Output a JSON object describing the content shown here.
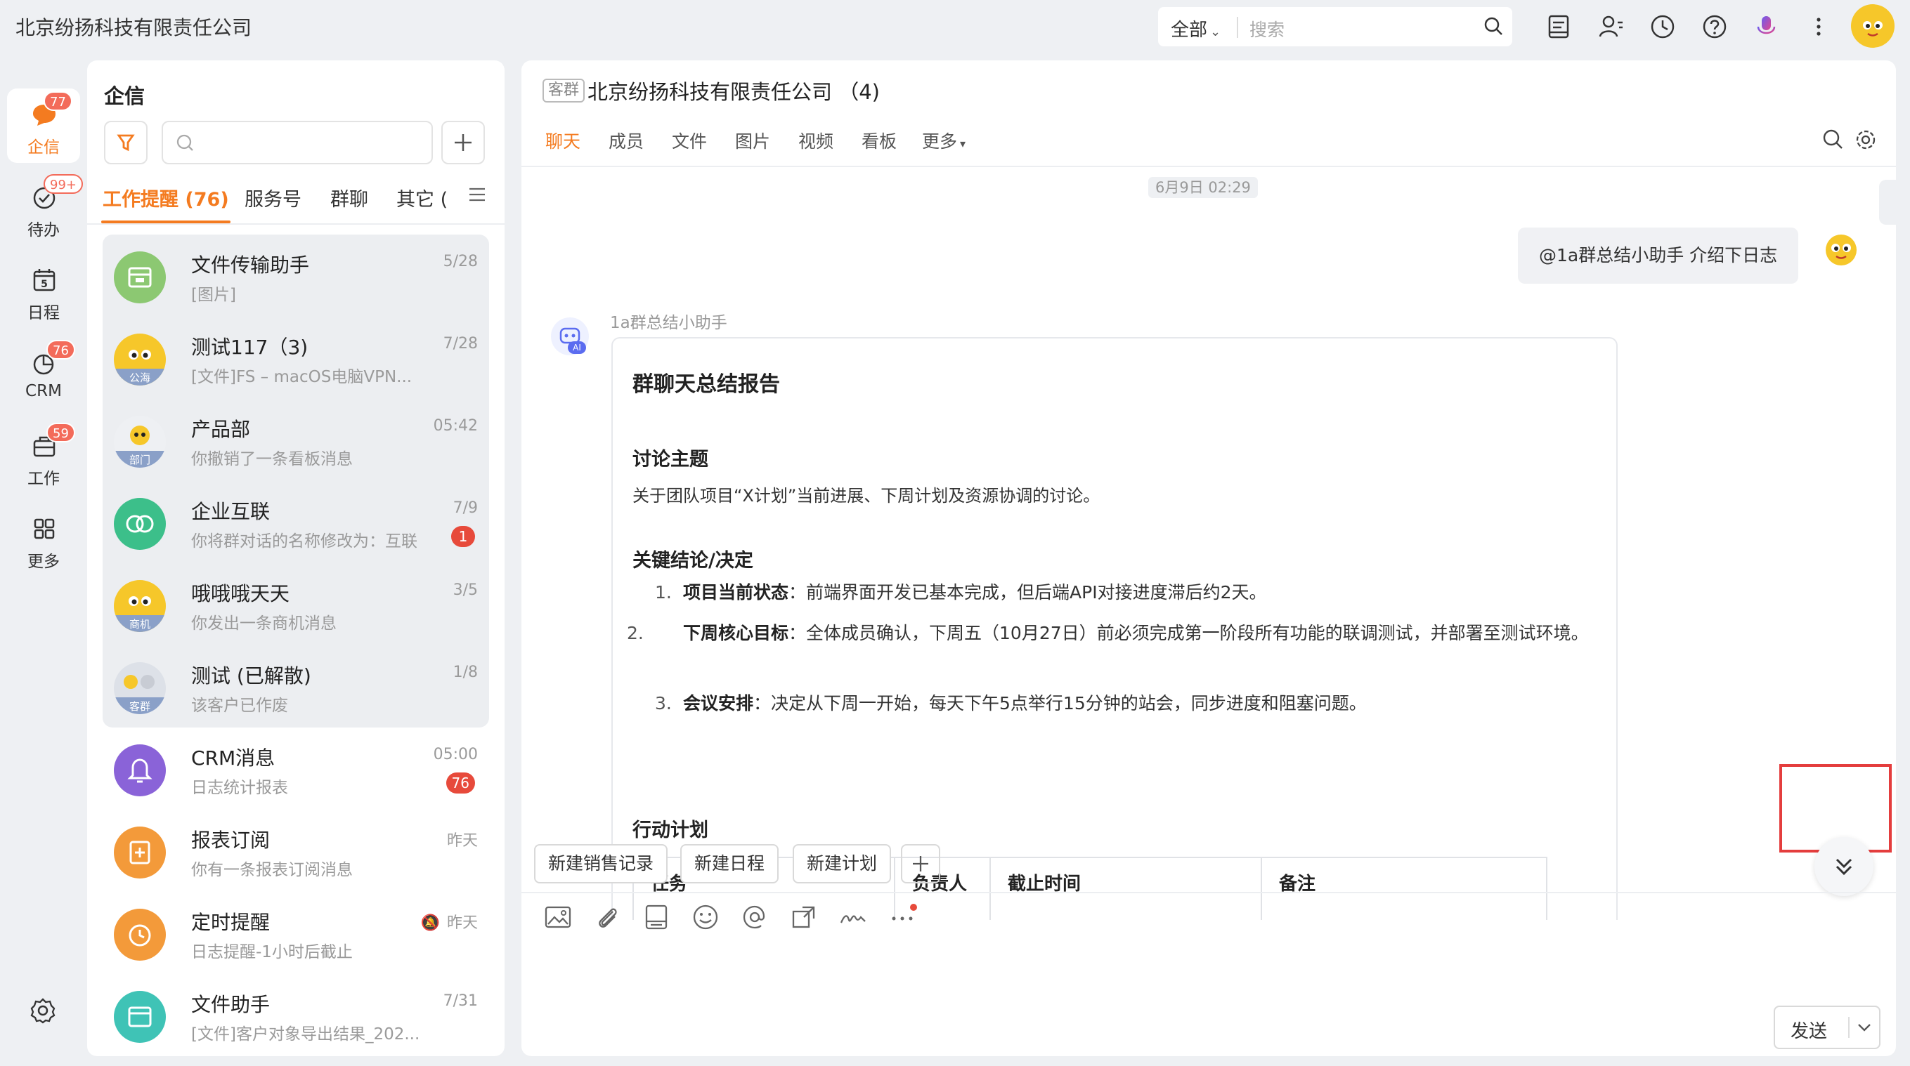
{
  "topbar": {
    "company": "北京纷扬科技有限责任公司",
    "search_scope": "全部",
    "search_placeholder": "搜索"
  },
  "nav": {
    "items": [
      {
        "label": "企信",
        "badge": "77",
        "icon": "chat-bubble-icon"
      },
      {
        "label": "待办",
        "badge": "99+",
        "icon": "checkmark-icon"
      },
      {
        "label": "日程",
        "badge": "",
        "icon": "calendar-icon",
        "day": "5"
      },
      {
        "label": "CRM",
        "badge": "76",
        "icon": "pie-chart-icon"
      },
      {
        "label": "工作",
        "badge": "59",
        "icon": "briefcase-icon"
      },
      {
        "label": "更多",
        "badge": "",
        "icon": "grid-icon"
      }
    ]
  },
  "list": {
    "title": "企信",
    "tabs": [
      "工作提醒 (76)",
      "服务号",
      "群聊",
      "其它 ("
    ],
    "conversations": [
      {
        "name": "文件传输助手",
        "sub": "[图片]",
        "time": "5/28",
        "badge": "",
        "avatar_color": "#8cc872"
      },
      {
        "name": "测试117（3)",
        "sub": "[文件]FS – macOS电脑VPN...",
        "time": "7/28",
        "badge": "",
        "avatar_color": "#f6c72a",
        "tag": "公海"
      },
      {
        "name": "产品部",
        "sub": "你撤销了一条看板消息",
        "time": "05:42",
        "badge": "",
        "avatar_color": "#f6c72a",
        "tag": "部门"
      },
      {
        "name": "企业互联",
        "sub": "你将群对话的名称修改为：互联",
        "time": "7/9",
        "badge": "1",
        "avatar_color": "#3cbf8a"
      },
      {
        "name": "哦哦哦天天",
        "sub": "你发出一条商机消息",
        "time": "3/5",
        "badge": "",
        "avatar_color": "#f6c72a",
        "tag": "商机"
      },
      {
        "name": "测试 (已解散)",
        "sub": "该客户已作废",
        "time": "1/8",
        "badge": "",
        "avatar_color": "#f6c72a",
        "tag": "客群"
      },
      {
        "name": "CRM消息",
        "sub": "日志统计报表",
        "time": "05:00",
        "badge": "76",
        "avatar_color": "#8a63d8"
      },
      {
        "name": "报表订阅",
        "sub": "你有一条报表订阅消息",
        "time": "昨天",
        "badge": "",
        "avatar_color": "#f39a3a"
      },
      {
        "name": "定时提醒",
        "sub": "日志提醒-1小时后截止",
        "time": "昨天",
        "badge": "",
        "avatar_color": "#f39a3a",
        "muted": true
      },
      {
        "name": "文件助手",
        "sub": "[文件]客户对象导出结果_202...",
        "time": "7/31",
        "badge": "",
        "avatar_color": "#3fc3b6"
      }
    ]
  },
  "chat": {
    "tag": "客群",
    "title": "北京纷扬科技有限责任公司 （4)",
    "tabs": [
      "聊天",
      "成员",
      "文件",
      "图片",
      "视频",
      "看板",
      "更多"
    ],
    "date": "6月9日 02:29",
    "my_message": "@1a群总结小助手 介绍下日志",
    "bot_name": "1a群总结小助手",
    "report": {
      "title": "群聊天总结报告",
      "topic_heading": "讨论主题",
      "topic_text": "关于团队项目“X计划”当前进展、下周计划及资源协调的讨论。",
      "decisions_heading": "关键结论/决定",
      "decisions": [
        {
          "num": "1.",
          "label": "项目当前状态",
          "text": "：前端界面开发已基本完成，但后端API对接进度滞后约2天。"
        },
        {
          "num": "2.",
          "label": "下周核心目标",
          "text": "：全体成员确认，下周五（10月27日）前必须完成第一阶段所有功能的联调测试，并部署至测试环境。"
        },
        {
          "num": "3.",
          "label": "会议安排",
          "text": "：决定从下周一开始，每天下午5点举行15分钟的站会，同步进度和阻塞问题。"
        }
      ],
      "plan_heading": "行动计划",
      "table_headers": [
        "任务",
        "负责人",
        "截止时间",
        "备注"
      ]
    },
    "quick_actions": [
      "新建销售记录",
      "新建日程",
      "新建计划"
    ],
    "send_label": "发送"
  },
  "colors": {
    "accent": "#f47b20",
    "badge": "#f36b5a",
    "highlight": "#e43d3d"
  }
}
